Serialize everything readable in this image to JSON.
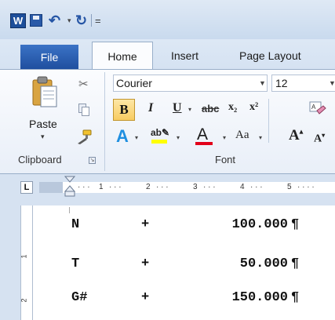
{
  "quick_access": {
    "app_icon_letter": "W",
    "more_glyph": "="
  },
  "tabs": {
    "file": "File",
    "home": "Home",
    "insert": "Insert",
    "page_layout": "Page Layout"
  },
  "clipboard_group": {
    "paste_label": "Paste",
    "group_label": "Clipboard"
  },
  "font_group": {
    "font_name": "Courier",
    "font_size": "12",
    "bold": "B",
    "italic": "I",
    "underline": "U",
    "strikethrough": "abc",
    "subscript": "x₂",
    "superscript": "x²",
    "change_case": "Aa",
    "grow_font": "A",
    "shrink_font": "A",
    "group_label": "Font",
    "highlight_color": "#ffff00",
    "font_color": "#e2001a"
  },
  "ruler": {
    "corner_glyph": "L",
    "numbers": [
      "1",
      "2",
      "3",
      "4",
      "5"
    ]
  },
  "vertical_ruler": {
    "numbers": [
      "1",
      "2"
    ]
  },
  "document": {
    "lines": [
      {
        "label": "N",
        "op": "+",
        "value": "100.000",
        "mark": "¶"
      },
      {
        "label": "T",
        "op": "+",
        "value": "50.000",
        "mark": "¶"
      },
      {
        "label": "G#",
        "op": "+",
        "value": "150.000",
        "mark": "¶"
      }
    ]
  }
}
